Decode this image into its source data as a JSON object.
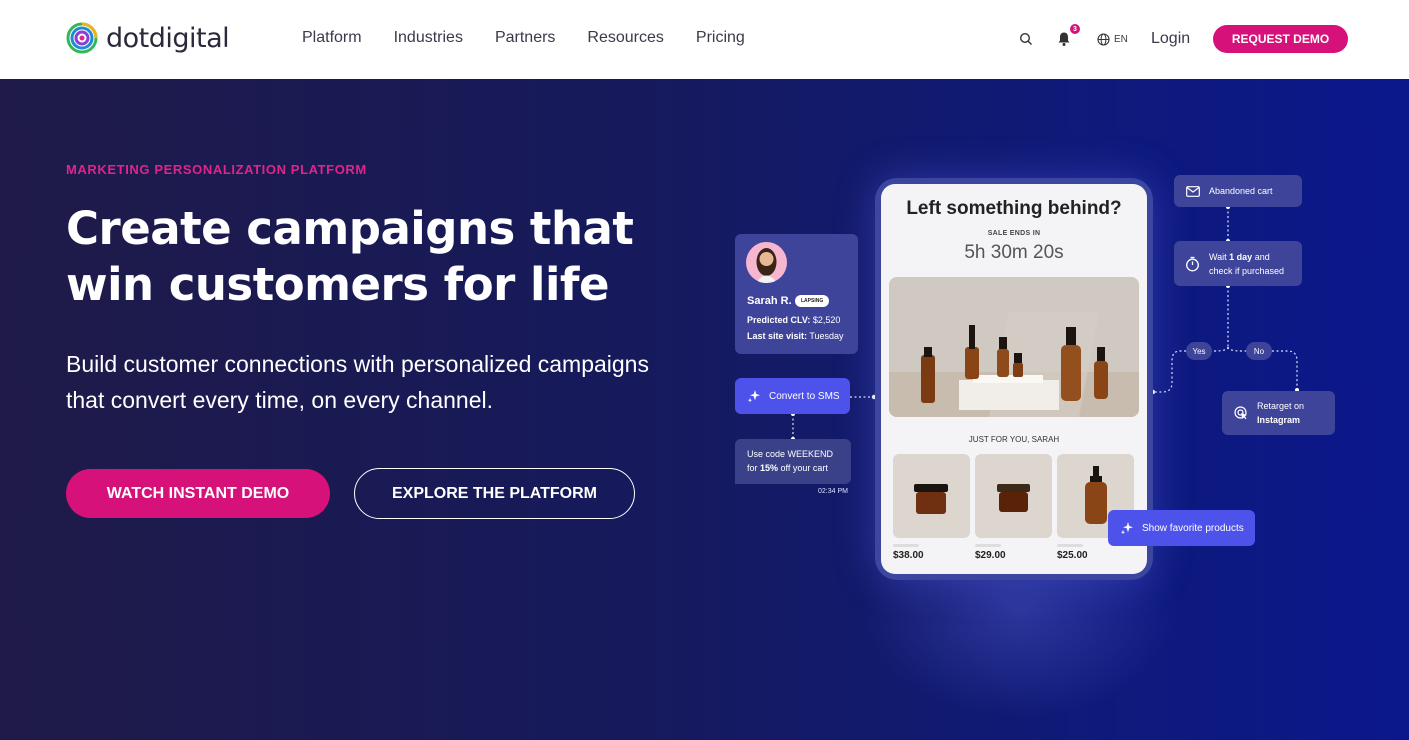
{
  "brand": {
    "name": "dotdigital",
    "accent": "#d6127a"
  },
  "nav": {
    "items": [
      "Platform",
      "Industries",
      "Partners",
      "Resources",
      "Pricing"
    ]
  },
  "header_utils": {
    "notification_count": "3",
    "language": "EN",
    "login_label": "Login",
    "request_demo_label": "REQUEST DEMO",
    "icons": [
      "search-icon",
      "bell-icon",
      "globe-icon"
    ]
  },
  "hero": {
    "eyebrow": "MARKETING PERSONALIZATION PLATFORM",
    "headline": "Create campaigns that win customers for life",
    "subheadline": "Build customer connections with personalized campaigns that convert every time, on every channel.",
    "cta_primary": "WATCH INSTANT DEMO",
    "cta_secondary": "EXPLORE THE PLATFORM"
  },
  "illustration": {
    "phone": {
      "title": "Left something behind?",
      "sale_label": "SALE ENDS IN",
      "timer": "5h 30m 20s",
      "for_you": "JUST FOR YOU, SARAH",
      "prices": [
        "$38.00",
        "$29.00",
        "$25.00"
      ]
    },
    "profile": {
      "name": "Sarah R.",
      "status": "LAPSING",
      "clv_label": "Predicted CLV:",
      "clv_value": "$2,520",
      "visit_label": "Last site visit:",
      "visit_value": "Tuesday"
    },
    "sms_action": "Convert to SMS",
    "code_message": {
      "line1": "Use code WEEKEND",
      "line2_pre": "for ",
      "line2_bold": "15%",
      "line2_post": " off your cart"
    },
    "code_time": "02:34 PM",
    "flow": {
      "abandoned_cart": "Abandoned cart",
      "wait_pre": "Wait ",
      "wait_bold": "1 day",
      "wait_post": " and",
      "wait_line2": "check if purchased",
      "yes": "Yes",
      "no": "No",
      "retarget_line1": "Retarget on",
      "retarget_line2": "Instagram",
      "favorites": "Show favorite products"
    }
  }
}
